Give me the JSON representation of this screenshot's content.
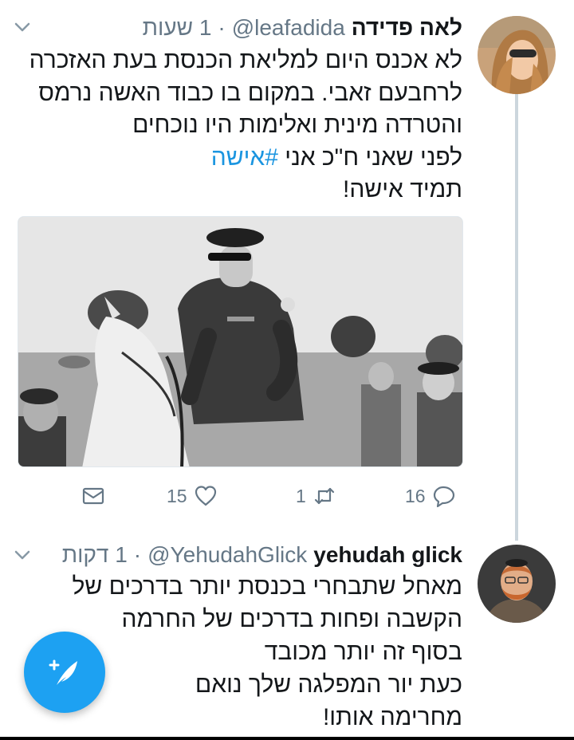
{
  "tweets": [
    {
      "display_name": "לאה פדידה",
      "handle": "@leafadida",
      "separator": "·",
      "time": "1 שעות",
      "text_lines": [
        "לא אכנס היום למליאת הכנסת בעת האזכרה",
        "לרחבעם זאבי. במקום בו כבוד האשה נרמס",
        "והטרדה מינית ואלימות היו נוכחים",
        "לפני שאני ח\"כ אני",
        "תמיד אישה!"
      ],
      "hashtag": "#אישה",
      "stats": {
        "likes": "15",
        "retweets": "1",
        "replies": "16"
      }
    },
    {
      "display_name": "yehudah glick",
      "handle": "@YehudahGlick",
      "separator": "·",
      "time": "1 דקות",
      "text_lines": [
        "מאחל שתבחרי בכנסת יותר בדרכים של",
        "הקשבה ופחות בדרכים של החרמה",
        "בסוף זה יותר מכובד",
        "כעת יור המפלגה שלך נואם",
        "מחרימה אותו!"
      ]
    }
  ],
  "colors": {
    "accent": "#1da1f2",
    "hashtag": "#1b95e0",
    "secondary_text": "#657786",
    "thread_line": "#ccd6dd"
  },
  "icons": {
    "caret": "chevron-down-icon",
    "dm": "envelope-icon",
    "like": "heart-icon",
    "retweet": "retweet-icon",
    "reply": "reply-icon",
    "compose": "compose-tweet-icon"
  }
}
